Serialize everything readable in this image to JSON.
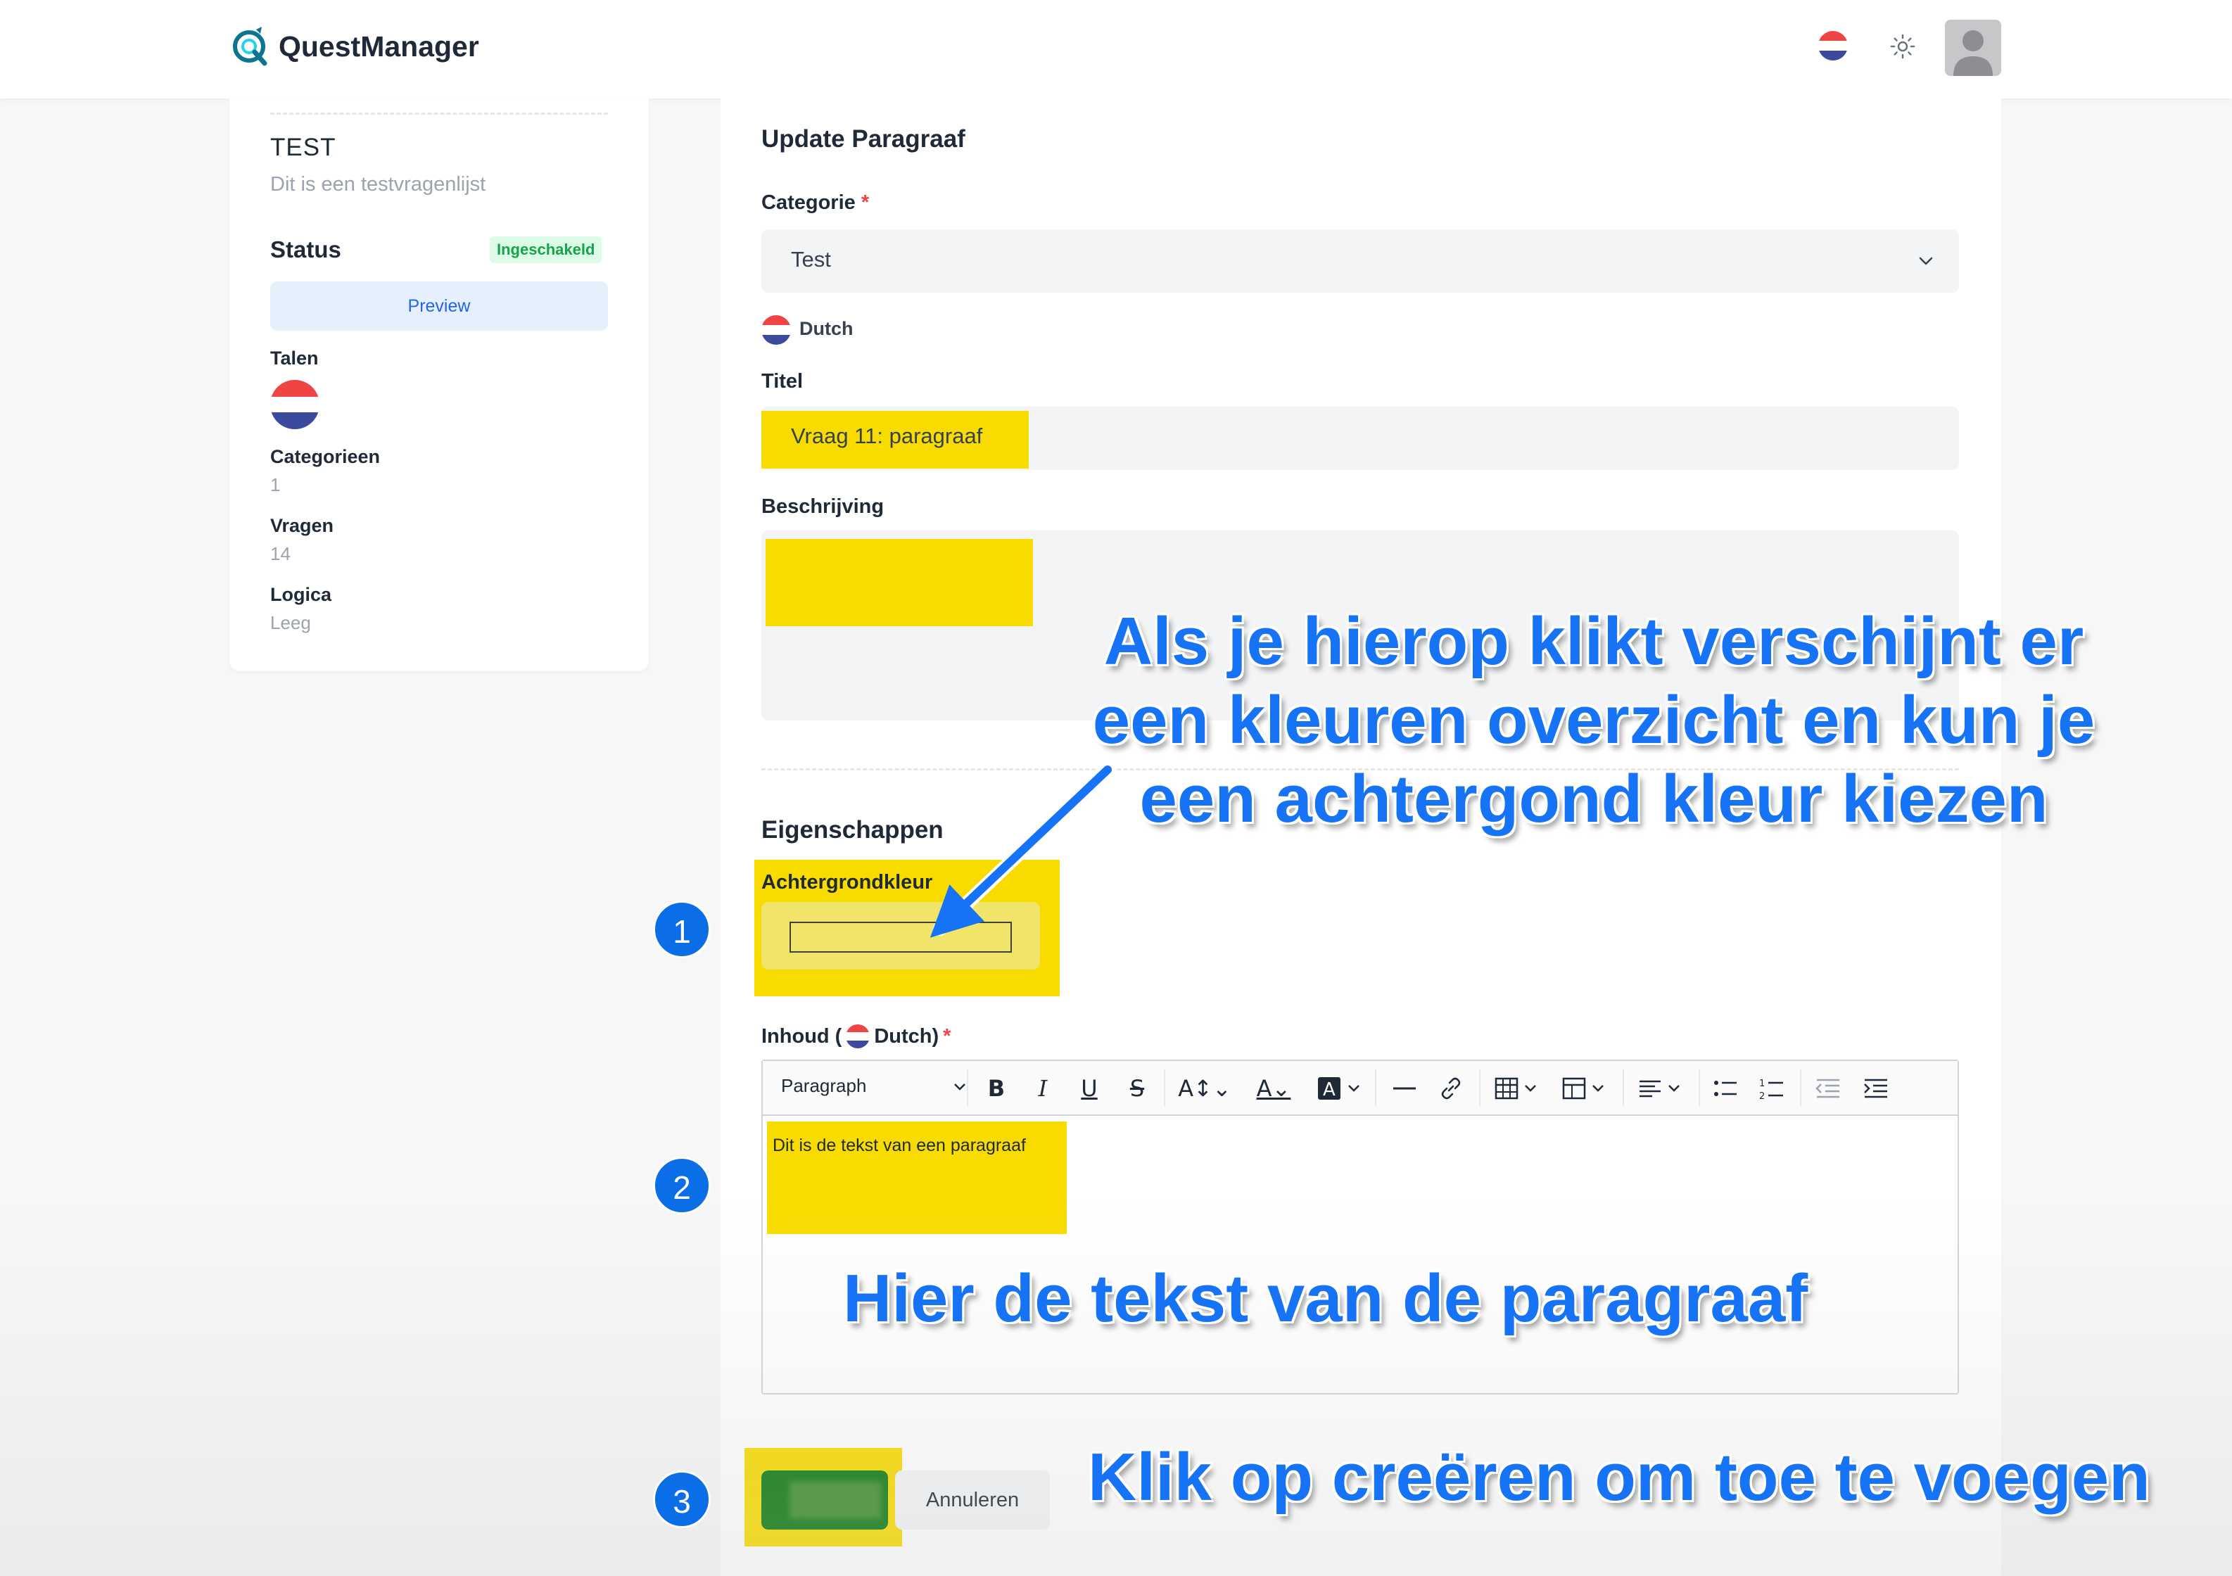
{
  "header": {
    "app_title": "QuestManager"
  },
  "sidebar": {
    "title": "TEST",
    "description": "Dit is een testvragenlijst",
    "status_label": "Status",
    "status_badge": "Ingeschakeld",
    "preview_label": "Preview",
    "talen_label": "Talen",
    "stats": [
      {
        "label": "Categorieen",
        "value": "1"
      },
      {
        "label": "Vragen",
        "value": "14"
      },
      {
        "label": "Logica",
        "value": "Leeg"
      }
    ]
  },
  "form": {
    "title": "Update Paragraaf",
    "categorie_label": "Categorie",
    "required_mark": "*",
    "categorie_value": "Test",
    "language_label": "Dutch",
    "titel_label": "Titel",
    "titel_value": "Vraag 11: paragraaf",
    "beschrijving_label": "Beschrijving",
    "eigenschappen_title": "Eigenschappen",
    "achtergrondkleur_label": "Achtergrondkleur",
    "inhoud_label_prefix": "Inhoud (",
    "inhoud_label_lang": "Dutch)",
    "editor_block_style": "Paragraph",
    "editor_content": "Dit is de tekst van een paragraaf",
    "cancel_label": "Annuleren"
  },
  "annotations": {
    "step1": "1",
    "step2": "2",
    "step3": "3",
    "note_color": "Als je hierop klikt verschijnt er een kleuren overzicht en kun je een achtergond kleur kiezen",
    "note_text": "Hier de tekst van de paragraaf",
    "note_create": "Klik op creëren om toe te voegen"
  },
  "colors": {
    "accent": "#2563eb",
    "highlight": "#f8dc00",
    "create_button": "#0d7a10",
    "annotation_blue": "#1673f5",
    "badge_green": "#16a34a"
  },
  "icons": [
    "logo-icon",
    "nl-flag-icon",
    "theme-sun-icon",
    "avatar-icon",
    "chevron-down-icon",
    "bold-icon",
    "italic-icon",
    "underline-icon",
    "strikethrough-icon",
    "font-size-icon",
    "font-color-icon",
    "highlight-color-icon",
    "horizontal-line-icon",
    "link-icon",
    "table-icon",
    "table-layout-icon",
    "align-icon",
    "bulleted-list-icon",
    "numbered-list-icon",
    "outdent-icon",
    "indent-icon",
    "arrow-icon"
  ]
}
